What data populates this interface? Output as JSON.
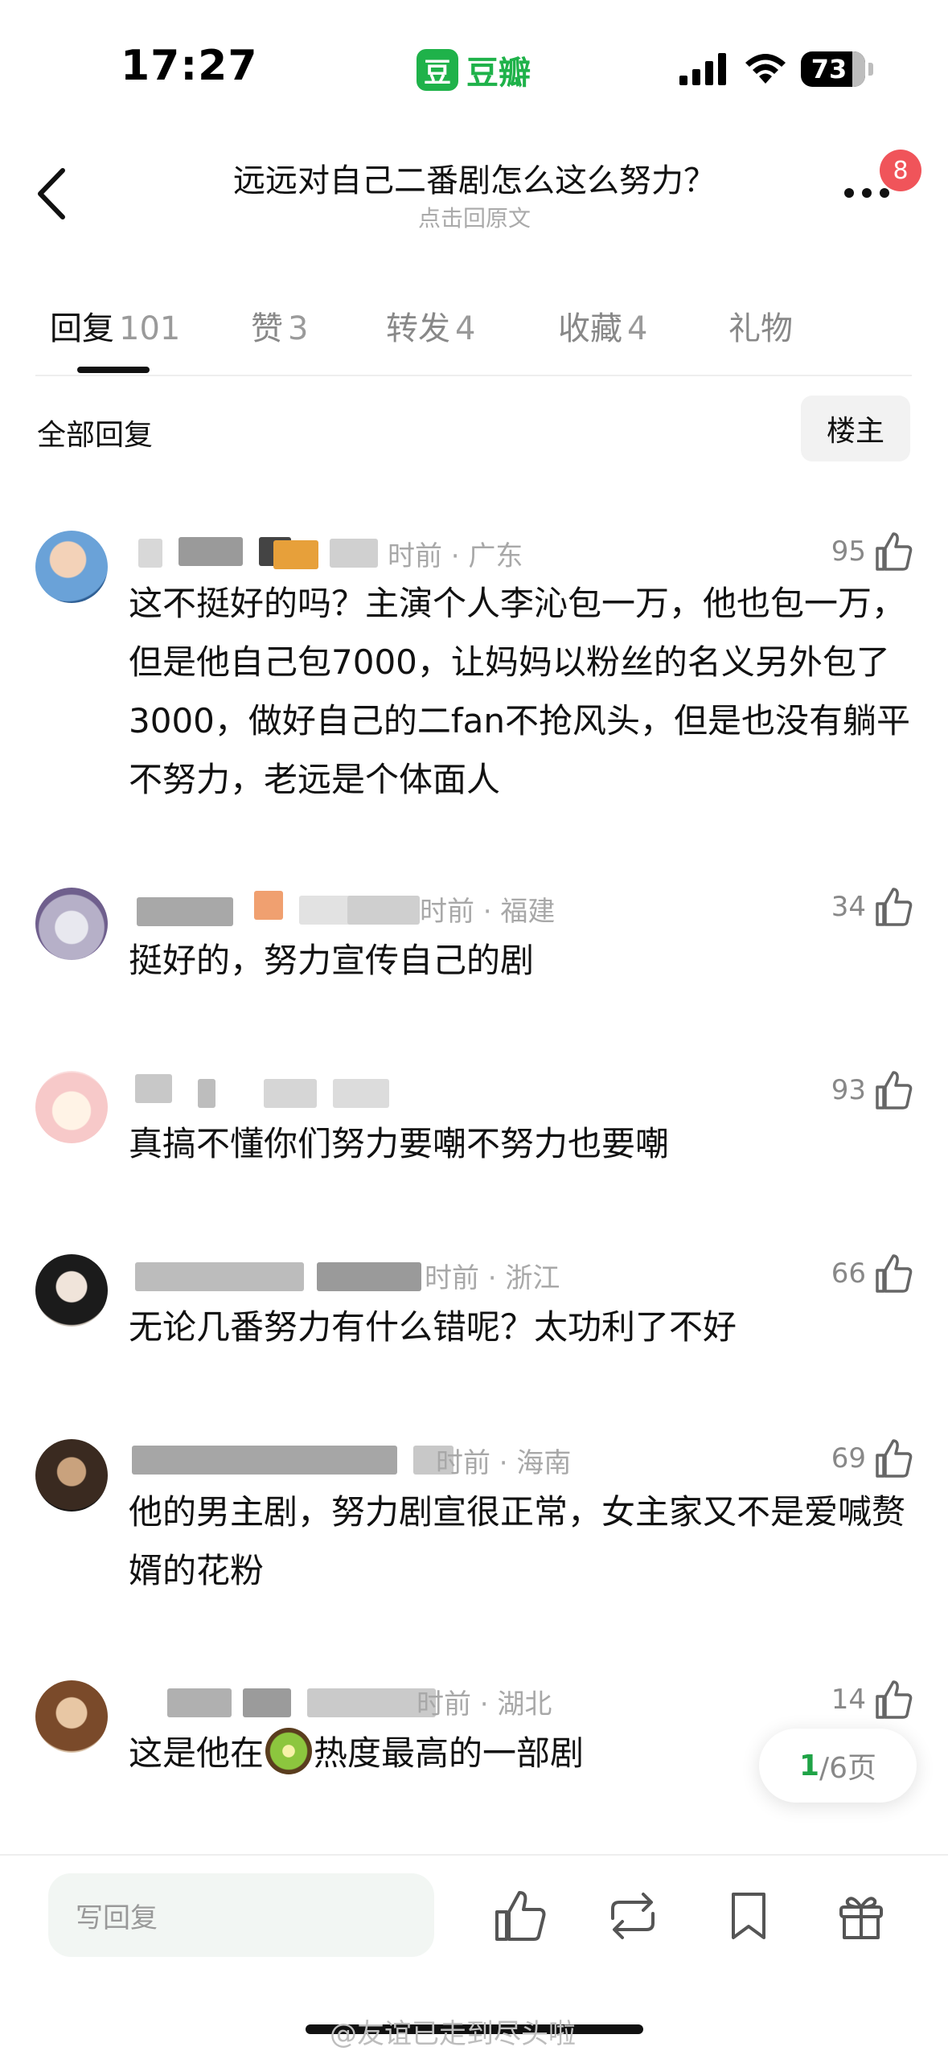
{
  "status_bar": {
    "time": "17:27",
    "app_logo_char": "豆",
    "app_name": "豆瓣",
    "battery": "73"
  },
  "header": {
    "title": "远远对自己二番剧怎么这么努力？",
    "subtitle": "点击回原文",
    "badge_count": "8"
  },
  "tabs": [
    {
      "label": "回复",
      "count": "101"
    },
    {
      "label": "赞",
      "count": "3"
    },
    {
      "label": "转发",
      "count": "4"
    },
    {
      "label": "收藏",
      "count": "4"
    },
    {
      "label": "礼物",
      "count": ""
    }
  ],
  "filter": {
    "label": "全部回复",
    "op_button": "楼主"
  },
  "comments": [
    {
      "meta": "时前 · 广东",
      "likes": "95",
      "text": "这不挺好的吗？主演个人李沁包一万，他也包一万，但是他自己包7000，让妈妈以粉丝的名义另外包了3000，做好自己的二fan不抢风头，但是也没有躺平不努力，老远是个体面人"
    },
    {
      "meta": "时前 · 福建",
      "likes": "34",
      "text": "挺好的，努力宣传自己的剧"
    },
    {
      "meta": "",
      "likes": "93",
      "text": "真搞不懂你们努力要嘲不努力也要嘲"
    },
    {
      "meta": "时前 · 浙江",
      "likes": "66",
      "text": "无论几番努力有什么错呢？太功利了不好"
    },
    {
      "meta": "时前 · 海南",
      "likes": "69",
      "text": "他的男主剧，努力剧宣很正常，女主家又不是爱喊赘婿的花粉"
    },
    {
      "meta": "时前 · 湖北",
      "likes": "14",
      "text_before": "这是他在",
      "text_after": "热度最高的一部剧"
    }
  ],
  "pager": {
    "current": "1",
    "total_label": "/6页"
  },
  "bottom_bar": {
    "reply_placeholder": "写回复"
  },
  "watermark": "@友谊已走到尽头啦",
  "icons": [
    "back-icon",
    "more-icon",
    "like-icon",
    "repost-icon",
    "bookmark-icon",
    "gift-icon",
    "kiwi-emoji-icon"
  ],
  "colors": {
    "brand_green": "#1fb24a",
    "badge_red": "#f0545a",
    "pager_green": "#1fa346"
  }
}
